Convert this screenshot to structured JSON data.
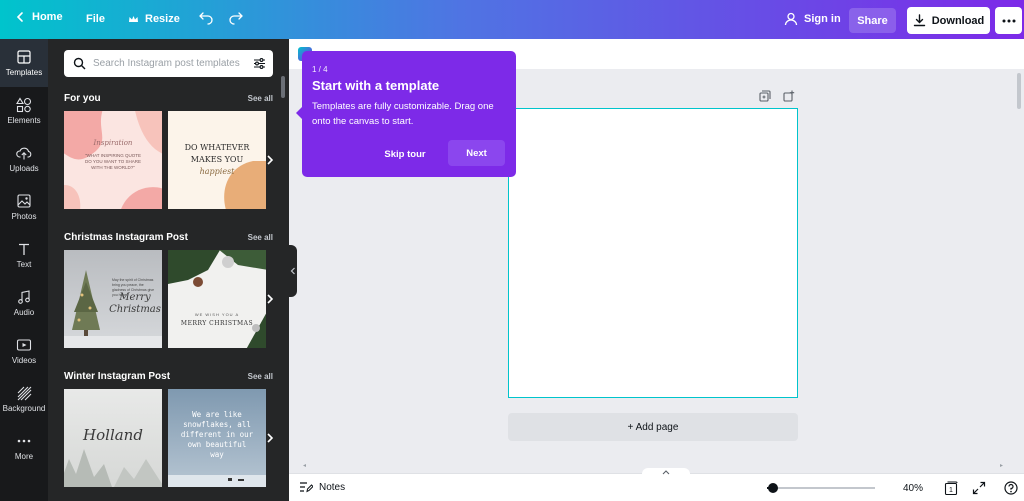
{
  "topbar": {
    "home_label": "Home",
    "file_label": "File",
    "resize_label": "Resize",
    "signin_label": "Sign in",
    "share_label": "Share",
    "download_label": "Download"
  },
  "rail": {
    "items": [
      {
        "label": "Templates",
        "icon": "templates-icon"
      },
      {
        "label": "Elements",
        "icon": "elements-icon"
      },
      {
        "label": "Uploads",
        "icon": "uploads-icon"
      },
      {
        "label": "Photos",
        "icon": "photos-icon"
      },
      {
        "label": "Text",
        "icon": "text-icon"
      },
      {
        "label": "Audio",
        "icon": "audio-icon"
      },
      {
        "label": "Videos",
        "icon": "videos-icon"
      },
      {
        "label": "Background",
        "icon": "background-icon"
      },
      {
        "label": "More",
        "icon": "more-icon"
      }
    ]
  },
  "panel": {
    "search_placeholder": "Search Instagram post templates",
    "see_all": "See all",
    "sections": [
      {
        "title": "For you",
        "thumbs": [
          {
            "script": "Inspiration",
            "text": "\"WHAT INSPIRING QUOTE DO YOU WANT TO SHARE WITH THE WORLD?\""
          },
          {
            "title_line1": "DO WHATEVER",
            "title_line2": "MAKES YOU",
            "script": "happiest"
          }
        ]
      },
      {
        "title": "Christmas Instagram Post",
        "thumbs": [
          {
            "small": "May the spirit of Christmas bring you peace, the gladness of Christmas give you hope",
            "script_line1": "Merry",
            "script_line2": "Christmas"
          },
          {
            "small": "WE WISH YOU A",
            "title": "MERRY CHRISTMAS"
          }
        ]
      },
      {
        "title": "Winter Instagram Post",
        "thumbs": [
          {
            "script": "Holland"
          },
          {
            "text_line1": "We are like",
            "text_line2": "snowflakes, all",
            "text_line3": "different in our",
            "text_line4": "own beautiful",
            "text_line5": "way"
          }
        ]
      }
    ]
  },
  "tooltip": {
    "step": "1 / 4",
    "title": "Start with a template",
    "body": "Templates are fully customizable. Drag one onto the canvas to start.",
    "skip_label": "Skip tour",
    "next_label": "Next"
  },
  "canvas": {
    "add_page_label": "+ Add page"
  },
  "bottombar": {
    "notes_label": "Notes",
    "zoom_value": "40%",
    "zoom_fraction": 0.06,
    "page_count": "1"
  },
  "colors": {
    "accent_purple": "#7d2ae8",
    "accent_teal": "#00c4cc",
    "sidebar_dark": "#18191b",
    "panel_dark": "#252627"
  }
}
